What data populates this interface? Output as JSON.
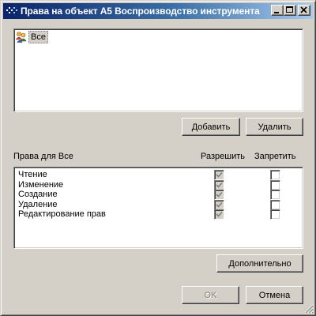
{
  "window": {
    "title": "Права на объект А5 Воспроизводство инструмента",
    "accent": "#0a246a"
  },
  "principals": {
    "items": [
      {
        "label": "Все",
        "icon": "users-group-icon",
        "selected": true
      }
    ]
  },
  "buttons": {
    "add": "Добавить",
    "remove": "Удалить",
    "advanced": "Дополнительно",
    "ok": "OK",
    "cancel": "Отмена"
  },
  "permissions": {
    "header_label": "Права для Все",
    "allow_header": "Разрешить",
    "deny_header": "Запретить",
    "rows": [
      {
        "label": "Чтение",
        "allow": true,
        "deny": false
      },
      {
        "label": "Изменение",
        "allow": true,
        "deny": false
      },
      {
        "label": "Создание",
        "allow": true,
        "deny": false
      },
      {
        "label": "Удаление",
        "allow": true,
        "deny": false
      },
      {
        "label": "Редактирование прав",
        "allow": true,
        "deny": false
      }
    ]
  }
}
